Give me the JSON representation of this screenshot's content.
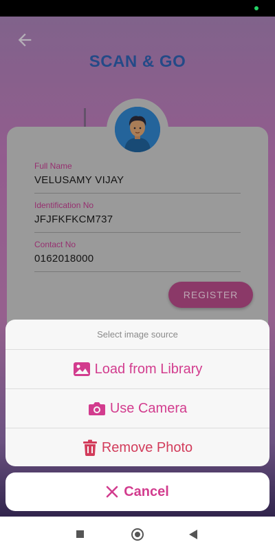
{
  "header": {
    "title": "SCAN & GO"
  },
  "form": {
    "fields": [
      {
        "label": "Full Name",
        "value": "VELUSAMY VIJAY"
      },
      {
        "label": "Identification No",
        "value": "JFJFKFKCM737"
      },
      {
        "label": "Contact No",
        "value": "0162018000"
      }
    ],
    "register_label": "REGISTER"
  },
  "sheet": {
    "title": "Select image source",
    "options": [
      {
        "label": "Load from Library",
        "icon": "image-icon"
      },
      {
        "label": "Use Camera",
        "icon": "camera-icon"
      },
      {
        "label": "Remove Photo",
        "icon": "trash-icon"
      }
    ],
    "cancel_label": "Cancel"
  },
  "colors": {
    "accent": "#d23c8e",
    "title_blue": "#2f5fae",
    "register": "#b24a86",
    "destructive": "#d23c5b"
  }
}
